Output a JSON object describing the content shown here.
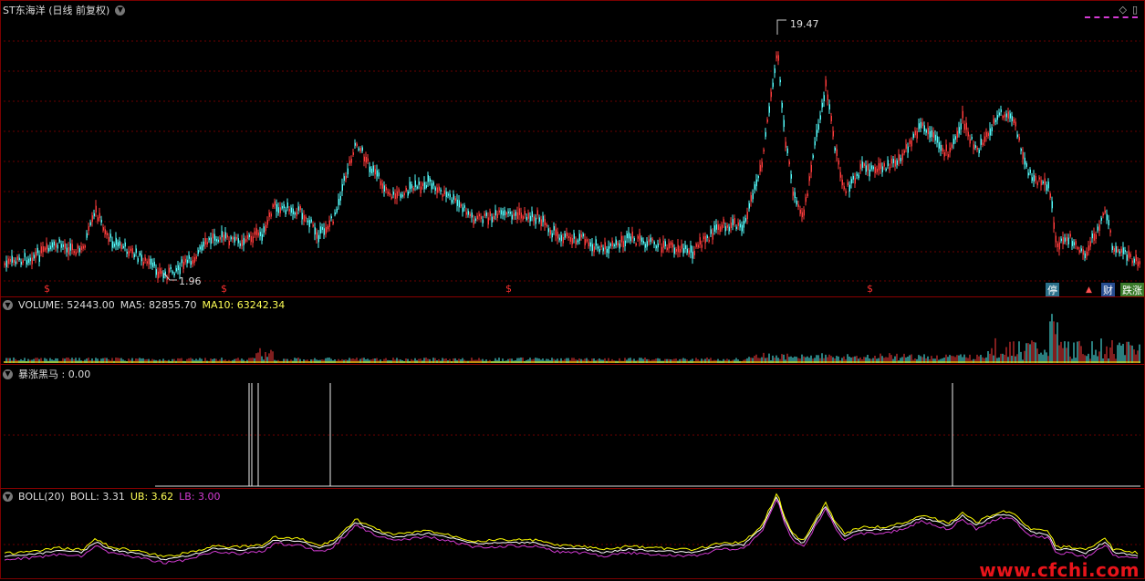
{
  "main": {
    "title": "ST东海洋 (日线 前复权)",
    "high_label": "19.47",
    "low_label": "1.96",
    "markers": [
      "$",
      "$",
      "$",
      "$"
    ],
    "badges": [
      "停",
      "财",
      "跌涨"
    ]
  },
  "volume": {
    "label": "VOLUME:",
    "value": "52443.00",
    "ma5_label": "MA5:",
    "ma5": "82855.70",
    "ma10_label": "MA10:",
    "ma10": "63242.34"
  },
  "signal": {
    "label": "暴涨黑马",
    "value": ": 0.00"
  },
  "boll": {
    "label": "BOLL(20)",
    "boll_label": "BOLL:",
    "boll": "3.31",
    "ub_label": "UB:",
    "ub": "3.62",
    "lb_label": "LB:",
    "lb": "3.00"
  },
  "watermark": "www.cfchi.com",
  "colors": {
    "up": "#ff3c3c",
    "down": "#54fcfc",
    "ma5": "#ffffff",
    "ma10": "#ffff00",
    "lb": "#d43bd4",
    "grid": "#6a0000"
  }
}
